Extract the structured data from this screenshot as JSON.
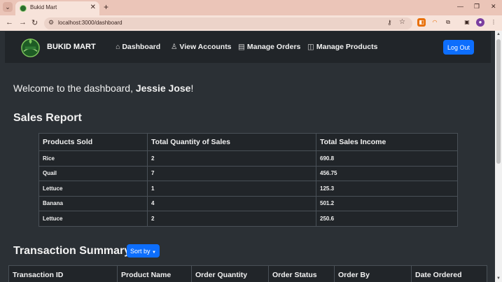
{
  "browser": {
    "tab_title": "Bukid Mart",
    "url": "localhost:3000/dashboard",
    "icons": [
      "tab-list-icon",
      "close-icon",
      "new-tab-icon",
      "back-icon",
      "forward-icon",
      "reload-icon",
      "site-info-icon",
      "password-key-icon",
      "star-icon",
      "extensions-icon",
      "sidebar-icon",
      "profile-icon",
      "menu-icon"
    ]
  },
  "navbar": {
    "brand": "BUKID MART",
    "links": [
      {
        "label": "Dashboard",
        "icon": "house-icon"
      },
      {
        "label": "View Accounts",
        "icon": "person-icon"
      },
      {
        "label": "Manage Orders",
        "icon": "list-icon"
      },
      {
        "label": "Manage Products",
        "icon": "bag-icon"
      }
    ],
    "logout": "Log Out"
  },
  "welcome": {
    "prefix": "Welcome to the dashboard, ",
    "name": "Jessie Jose",
    "suffix": "!"
  },
  "sales_report": {
    "title": "Sales Report",
    "columns": [
      "Products Sold",
      "Total Quantity of Sales",
      "Total Sales Income"
    ],
    "rows": [
      [
        "Rice",
        "2",
        "690.8"
      ],
      [
        "Quail",
        "7",
        "456.75"
      ],
      [
        "Lettuce",
        "1",
        "125.3"
      ],
      [
        "Banana",
        "4",
        "501.2"
      ],
      [
        "Lettuce",
        "2",
        "250.6"
      ]
    ]
  },
  "transactions": {
    "title": "Transaction Summary",
    "sort_label": "Sort by",
    "columns": [
      "Transaction ID",
      "Product Name",
      "Order Quantity",
      "Order Status",
      "Order By",
      "Date Ordered"
    ]
  },
  "colors": {
    "page_bg": "#2b3035",
    "navbar_bg": "#212529",
    "primary": "#0d6efd",
    "browser_chrome": "#ebc5b8"
  }
}
